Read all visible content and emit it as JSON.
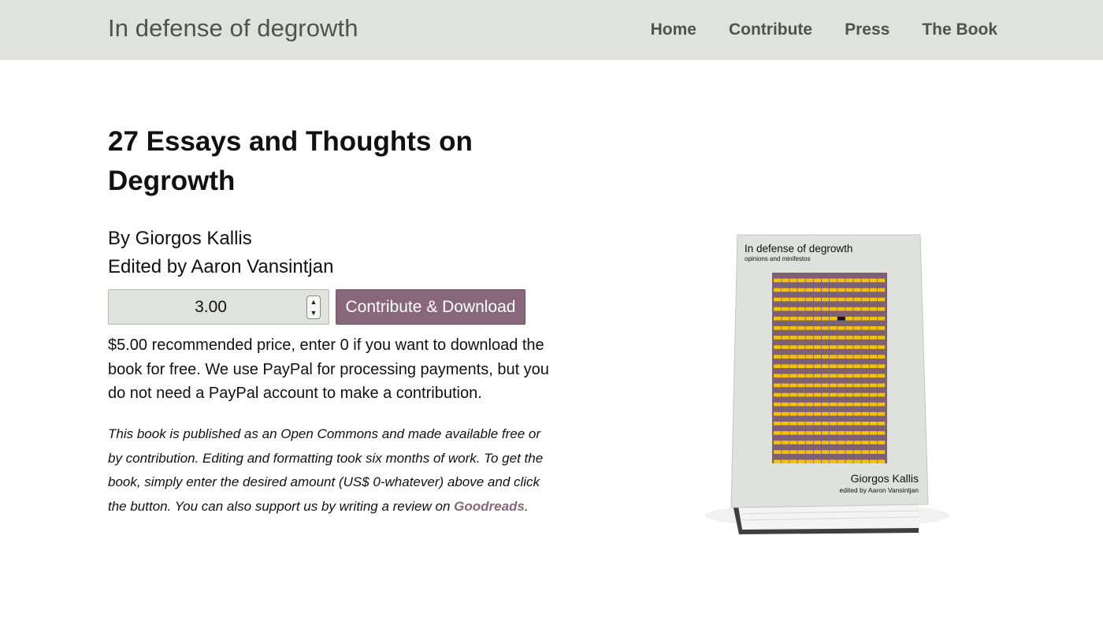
{
  "header": {
    "site_title": "In defense of degrowth",
    "nav": [
      {
        "label": "Home"
      },
      {
        "label": "Contribute"
      },
      {
        "label": "Press"
      },
      {
        "label": "The Book"
      }
    ]
  },
  "main": {
    "title": "27 Essays and Thoughts on Degrowth",
    "author_line": "By Giorgos Kallis",
    "editor_line": "Edited by Aaron Vansintjan",
    "amount_value": "3.00",
    "cta_label": "Contribute & Download",
    "recommendation": "$5.00 recommended price, enter 0 if you want to download the book for free. We use PayPal for processing payments, but you do not need a PayPal account to make a contribution.",
    "note_text": "This book is published as an Open Commons and made available free or by contribution. Editing and formatting took six months of work. To get the book, simply enter the desired amount (US$ 0-whatever) above and click the button. You can also support us by writing a review on ",
    "note_link": "Goodreads",
    "note_end": "."
  },
  "book": {
    "cover_title": "In defense of degrowth",
    "cover_subtitle": "opinions and minifestos",
    "cover_author": "Giorgos Kallis",
    "cover_editor": "edited by Aaron Vansintjan",
    "colors": {
      "cover": "#dfe1dc",
      "stripe_purple": "#7d6073",
      "stripe_yellow": "#f4c20d",
      "accent": "#876779"
    }
  }
}
